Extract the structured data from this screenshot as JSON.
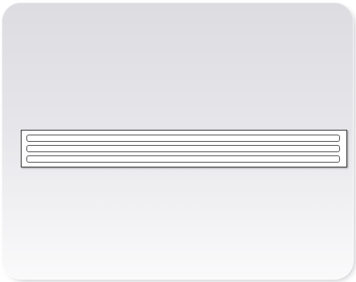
{
  "fields": [
    {
      "value": ""
    },
    {
      "value": ""
    },
    {
      "value": ""
    }
  ]
}
